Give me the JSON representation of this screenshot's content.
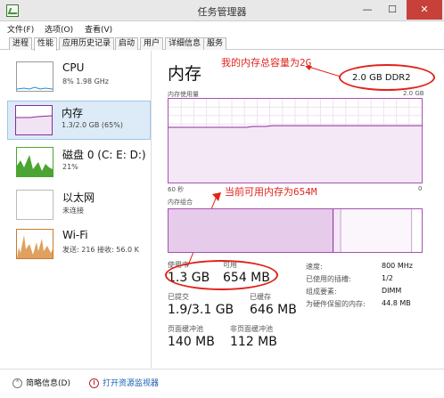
{
  "window": {
    "title": "任务管理器",
    "minimize": "—",
    "maximize": "☐",
    "close": "✕"
  },
  "menu": [
    "文件(F)",
    "选项(O)",
    "查看(V)"
  ],
  "tabs": [
    "进程",
    "性能",
    "应用历史记录",
    "启动",
    "用户",
    "详细信息",
    "服务"
  ],
  "active_tab": "性能",
  "sidebar": {
    "items": [
      {
        "name": "CPU",
        "sub": "8% 1.98 GHz",
        "color": "#1f8dd6"
      },
      {
        "name": "内存",
        "sub": "1.3/2.0 GB (65%)",
        "color": "#8b2a9c"
      },
      {
        "name": "磁盘 0 (C: E: D:)",
        "sub": "21%",
        "color": "#4aa532"
      },
      {
        "name": "以太网",
        "sub": "未连接",
        "color": "#a0a0a0"
      },
      {
        "name": "Wi-Fi",
        "sub": "发送: 216 接收: 56.0 K",
        "color": "#c97a2a"
      }
    ]
  },
  "main": {
    "title": "内存",
    "ram_spec": "2.0 GB DDR2",
    "usage_chart": {
      "label": "内存使用量",
      "max": "2.0 GB",
      "time_left": "60 秒",
      "time_right": "0",
      "values": [
        66,
        66,
        66,
        66,
        66,
        66,
        66,
        66,
        66,
        66,
        66,
        66,
        66,
        67,
        67,
        67,
        68,
        68,
        68,
        68,
        68,
        68,
        68,
        68,
        68,
        68,
        68,
        68,
        68,
        68,
        68,
        68,
        68,
        68,
        68,
        68,
        68,
        68,
        68,
        68
      ]
    },
    "composition_chart": {
      "label": "内存组合",
      "in_use_fraction": 0.65,
      "modified_fraction": 0.03,
      "standby_fraction": 0.28
    },
    "stats": {
      "in_use_label": "使用中",
      "in_use": "1.3 GB",
      "available_label": "可用",
      "available": "654 MB",
      "committed_label": "已提交",
      "committed": "1.9/3.1 GB",
      "cached_label": "已缓存",
      "cached": "646 MB",
      "paged_label": "页面缓冲池",
      "paged": "140 MB",
      "nonpaged_label": "非页面缓冲池",
      "nonpaged": "112 MB"
    },
    "specs": [
      {
        "key": "速度:",
        "value": "800 MHz"
      },
      {
        "key": "已使用的插槽:",
        "value": "1/2"
      },
      {
        "key": "组成要素:",
        "value": "DIMM"
      },
      {
        "key": "为硬件保留的内存:",
        "value": "44.8 MB"
      }
    ]
  },
  "annotations": {
    "total_capacity": "我的内存总容量为2G",
    "available_now": "当前可用内存为654M"
  },
  "footer": {
    "summary": "简略信息(D)",
    "resource_monitor": "打开资源监视器"
  },
  "colors": {
    "memory": "#8b2a9c",
    "annotation_red": "#e0231c"
  }
}
